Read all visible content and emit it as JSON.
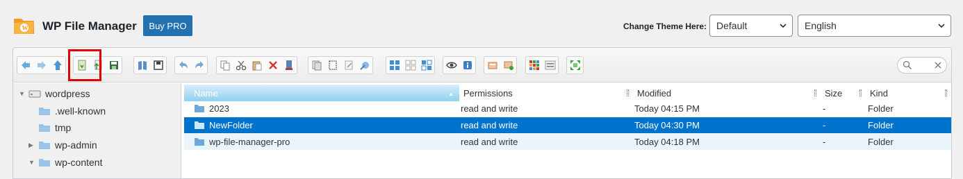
{
  "header": {
    "app_title": "WP File Manager",
    "buy_pro_label": "Buy PRO",
    "theme_label": "Change Theme Here:",
    "theme_value": "Default",
    "language_value": "English"
  },
  "colors": {
    "accent": "#2271b1",
    "selected_row": "#0074cc",
    "highlight": "#e00000",
    "folder": "#6ea8d8"
  },
  "toolbar": {
    "highlighted_button": "get-file-button",
    "groups": [
      [
        "back-icon",
        "forward-icon",
        "up-icon"
      ],
      [
        "get-file-icon",
        "upload-icon",
        "save-icon"
      ],
      [
        "open-icon",
        "download-icon"
      ],
      [
        "undo-icon",
        "redo-icon"
      ],
      [
        "copy-icon",
        "cut-icon",
        "paste-icon",
        "delete-icon",
        "empty-icon"
      ],
      [
        "duplicate-icon",
        "select-icon",
        "rename-icon",
        "edit-icon"
      ],
      [
        "select-all-icon",
        "select-none-icon",
        "invert-selection-icon"
      ],
      [
        "preview-icon",
        "info-icon"
      ],
      [
        "extract-icon",
        "archive-icon"
      ],
      [
        "icons-view-icon",
        "list-view-icon"
      ],
      [
        "fullscreen-icon"
      ]
    ]
  },
  "tree": [
    {
      "label": "wordpress",
      "level": 0,
      "expanded": true,
      "root": true
    },
    {
      "label": ".well-known",
      "level": 1
    },
    {
      "label": "tmp",
      "level": 1
    },
    {
      "label": "wp-admin",
      "level": 1,
      "collapsed": true
    },
    {
      "label": "wp-content",
      "level": 1,
      "expanded": true
    }
  ],
  "columns": {
    "name": "Name",
    "permissions": "Permissions",
    "modified": "Modified",
    "size": "Size",
    "kind": "Kind"
  },
  "files": [
    {
      "name": "2023",
      "permissions": "read and write",
      "modified": "Today 04:15 PM",
      "size": "-",
      "kind": "Folder"
    },
    {
      "name": "NewFolder",
      "permissions": "read and write",
      "modified": "Today 04:30 PM",
      "size": "-",
      "kind": "Folder",
      "selected": true
    },
    {
      "name": "wp-file-manager-pro",
      "permissions": "read and write",
      "modified": "Today 04:18 PM",
      "size": "-",
      "kind": "Folder"
    }
  ]
}
